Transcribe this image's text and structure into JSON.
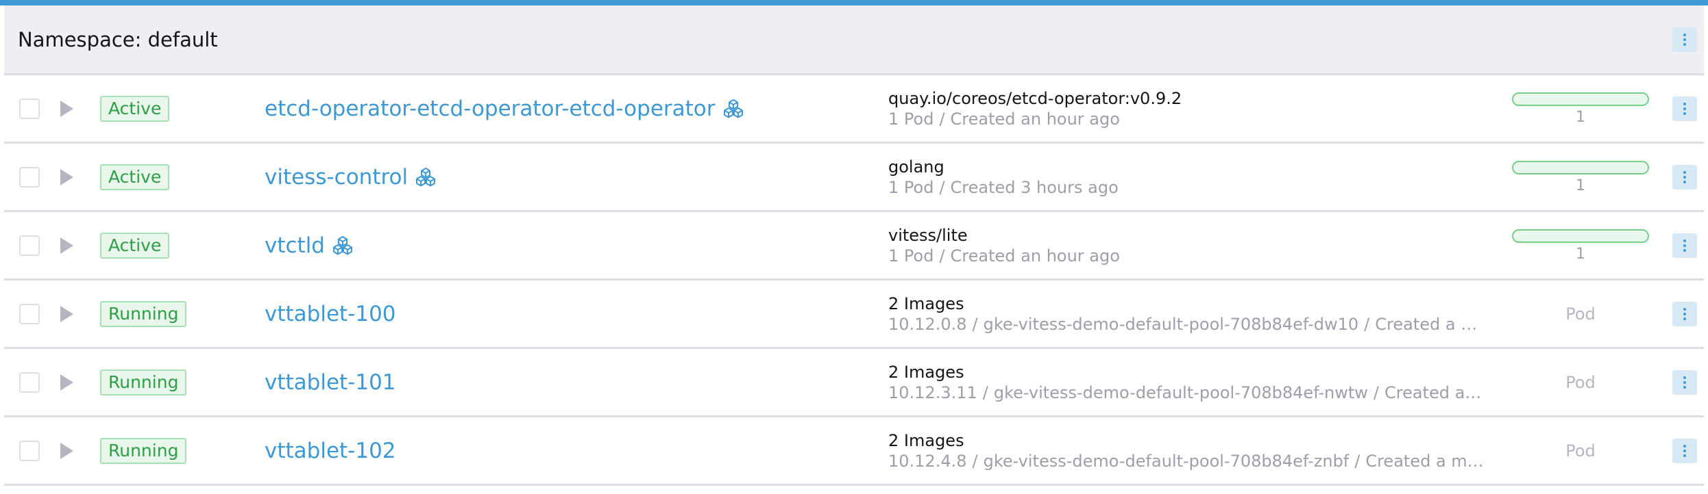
{
  "colors": {
    "accent": "#3d98d3",
    "state_green": "#2e9e45",
    "muted": "#9e9eaa"
  },
  "group": {
    "title": "Namespace: default"
  },
  "rows": [
    {
      "state": "Active",
      "name": "etcd-operator-etcd-operator-etcd-operator",
      "icon": "workload-cubes-icon",
      "image": "quay.io/coreos/etcd-operator:v0.9.2",
      "sub1": "1 Pod",
      "sub2": "Created an hour ago",
      "scale": 1,
      "scale_fraction": 1.0
    },
    {
      "state": "Active",
      "name": "vitess-control",
      "icon": "workload-cubes-icon",
      "image": "golang",
      "sub1": "1 Pod",
      "sub2": "Created 3 hours ago",
      "scale": 1,
      "scale_fraction": 1.0
    },
    {
      "state": "Active",
      "name": "vtctld",
      "icon": "workload-cubes-icon",
      "image": "vitess/lite",
      "sub1": "1 Pod",
      "sub2": "Created an hour ago",
      "scale": 1,
      "scale_fraction": 1.0
    },
    {
      "state": "Running",
      "name": "vttablet-100",
      "image": "2 Images",
      "sub1": "10.12.0.8",
      "sub2": "gke-vitess-demo-default-pool-708b84ef-dw10",
      "sub3": "Created a min...",
      "type": "Pod"
    },
    {
      "state": "Running",
      "name": "vttablet-101",
      "image": "2 Images",
      "sub1": "10.12.3.11",
      "sub2": "gke-vitess-demo-default-pool-708b84ef-nwtw",
      "sub3": "Created a mi...",
      "type": "Pod"
    },
    {
      "state": "Running",
      "name": "vttablet-102",
      "image": "2 Images",
      "sub1": "10.12.4.8",
      "sub2": "gke-vitess-demo-default-pool-708b84ef-znbf",
      "sub3": "Created a min...",
      "type": "Pod"
    }
  ]
}
